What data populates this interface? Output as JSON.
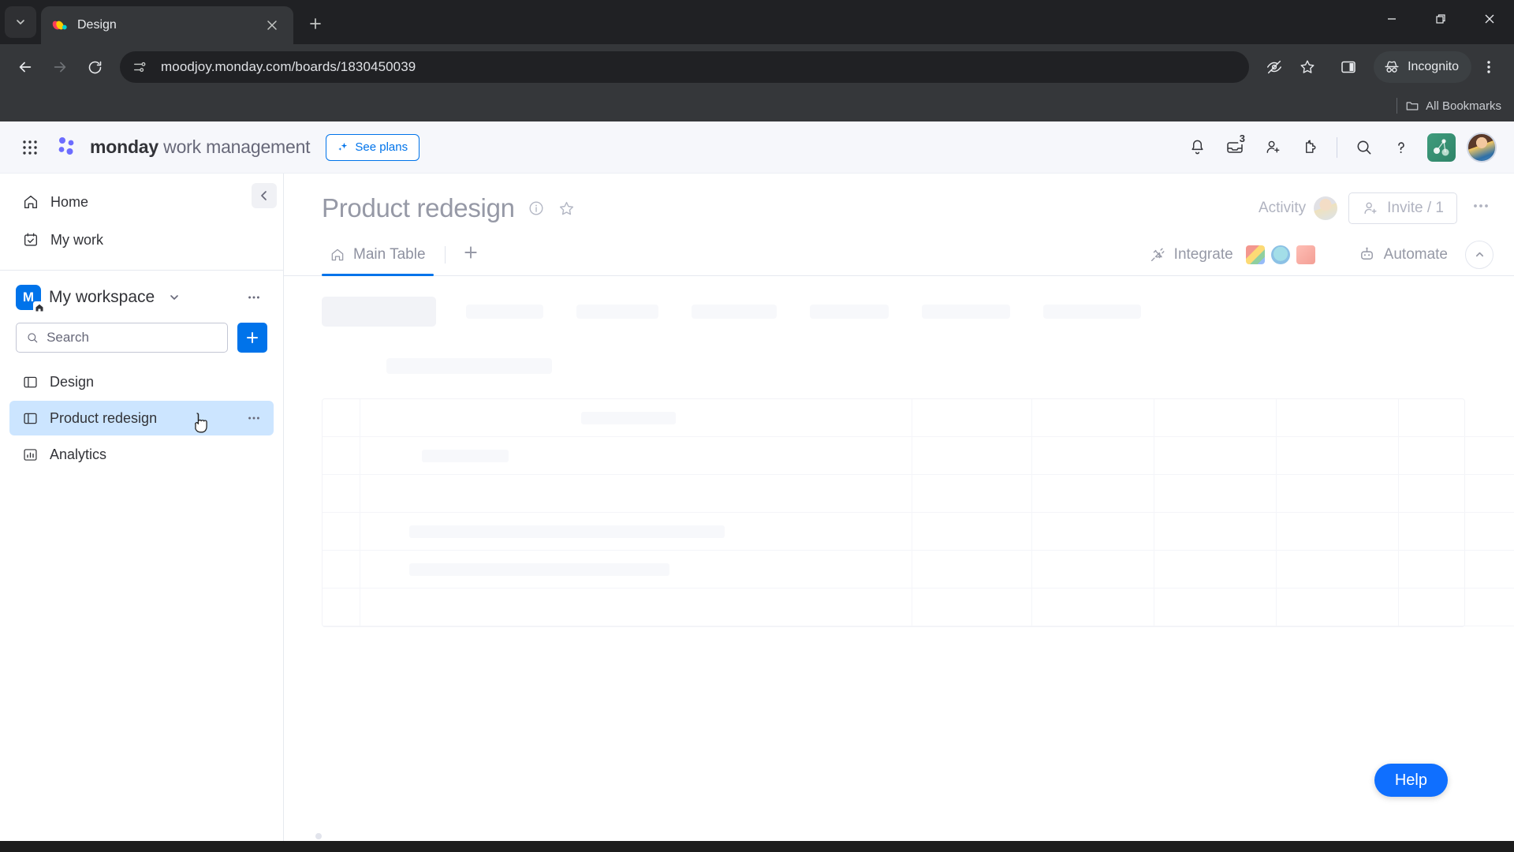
{
  "browser": {
    "tab": {
      "title": "Design",
      "favicon": "monday-logo-icon"
    },
    "tab_list_icon": "chevron-down-icon",
    "new_tab_icon": "plus-icon",
    "window_controls": {
      "minimize": "minimize-icon",
      "maximize": "restore-icon",
      "close": "close-icon"
    },
    "nav": {
      "back": "back-arrow-icon",
      "forward": "forward-arrow-icon",
      "reload": "reload-icon"
    },
    "omnibox": {
      "site_settings_icon": "tune-icon",
      "url": "moodjoy.monday.com/boards/1830450039"
    },
    "actions": {
      "tracking_protection": "eye-slash-icon",
      "bookmark": "star-icon",
      "side_panel": "side-panel-icon",
      "incognito_label": "Incognito",
      "incognito_icon": "incognito-hat-icon",
      "menu": "three-dots-vertical-icon"
    },
    "bookmarks_bar": {
      "folder_icon": "folder-icon",
      "label": "All Bookmarks"
    }
  },
  "app_header": {
    "waffle_icon": "apps-grid-icon",
    "logo_icon": "monday-dots-logo-icon",
    "brand_bold": "monday",
    "brand_rest": " work management",
    "see_plans": {
      "label": "See plans",
      "icon": "sparkle-icon"
    },
    "icons": [
      {
        "name": "notifications-bell-icon",
        "badge": ""
      },
      {
        "name": "inbox-icon",
        "badge": "3"
      },
      {
        "name": "invite-member-icon",
        "badge": ""
      },
      {
        "name": "apps-puzzle-icon",
        "badge": ""
      },
      {
        "name": "search-icon",
        "badge": ""
      },
      {
        "name": "help-question-icon",
        "badge": ""
      }
    ],
    "product_switch_icon": "product-tile-icon",
    "avatar": "user-avatar"
  },
  "sidebar": {
    "collapse_icon": "chevron-left-icon",
    "nav": [
      {
        "label": "Home",
        "icon": "home-icon"
      },
      {
        "label": "My work",
        "icon": "calendar-check-icon"
      }
    ],
    "workspace": {
      "initial": "M",
      "name": "My workspace",
      "home_badge_icon": "home-small-icon",
      "caret_icon": "chevron-down-icon",
      "dots_icon": "three-dots-icon"
    },
    "search": {
      "placeholder": "Search",
      "value": "",
      "icon": "search-icon"
    },
    "add_button": {
      "label": "+",
      "icon": "plus-icon"
    },
    "boards": [
      {
        "label": "Design",
        "icon": "board-icon",
        "selected": false
      },
      {
        "label": "Product redesign",
        "icon": "board-icon",
        "selected": true,
        "dots": "..."
      },
      {
        "label": "Analytics",
        "icon": "chart-bars-icon",
        "selected": false
      }
    ]
  },
  "board": {
    "title": "Product redesign",
    "info_icon": "info-circle-icon",
    "favorite_icon": "star-outline-icon",
    "activity": {
      "label": "Activity",
      "avatar": "activity-avatar"
    },
    "invite": {
      "label": "Invite / 1",
      "icon": "person-add-icon"
    },
    "more_icon": "three-dots-icon",
    "tabs": [
      {
        "label": "Main Table",
        "icon": "home-icon",
        "active": true
      }
    ],
    "add_tab_icon": "plus-icon",
    "integrate": {
      "label": "Integrate",
      "icon": "plug-icon"
    },
    "integration_apps": [
      "gmail-icon",
      "teams-icon",
      "outlook-icon"
    ],
    "automate": {
      "label": "Automate",
      "icon": "robot-icon"
    },
    "collapse_icon": "chevron-up-icon",
    "loading": true
  },
  "help_button": {
    "label": "Help"
  },
  "colors": {
    "accent_blue": "#0073ea",
    "help_blue": "#0f6fff",
    "selected_item": "#cce5ff",
    "chrome_dark": "#35373a",
    "chrome_darker": "#202124",
    "text_primary": "#323338",
    "text_muted": "#676879",
    "skeleton": "#f2f3f7"
  }
}
